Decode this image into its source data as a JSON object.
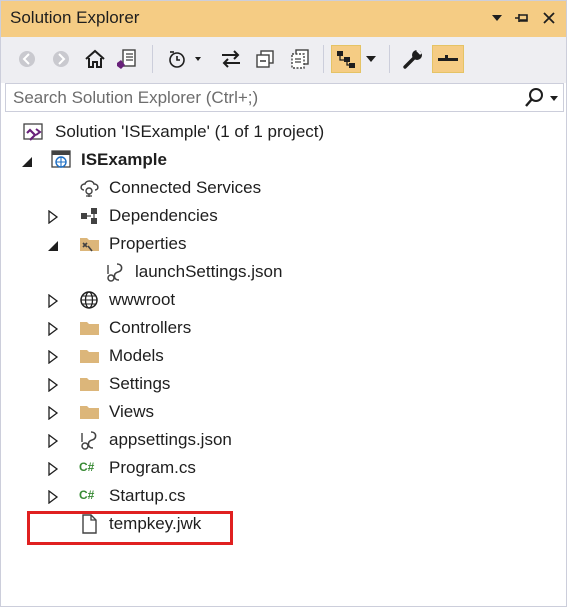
{
  "window": {
    "title": "Solution Explorer",
    "title_buttons": [
      "dropdown-icon",
      "pin-icon",
      "close-icon"
    ]
  },
  "toolbar": {
    "buttons": [
      "back-icon",
      "forward-icon",
      "home-icon",
      "switch-views-icon",
      "pending-changes-filter-icon",
      "sync-with-active-document-icon",
      "collapse-all-icon",
      "show-all-files-icon",
      "toggle-tree-icon",
      "properties-icon",
      "preview-selected-items-icon"
    ]
  },
  "search": {
    "placeholder": "Search Solution Explorer (Ctrl+;)",
    "value": ""
  },
  "tree": {
    "solution": "Solution 'ISExample' (1 of 1 project)",
    "project": "ISExample",
    "items": {
      "connected_services": "Connected Services",
      "dependencies": "Dependencies",
      "properties": "Properties",
      "launch_settings": "launchSettings.json",
      "wwwroot": "wwwroot",
      "controllers": "Controllers",
      "models": "Models",
      "settings": "Settings",
      "views": "Views",
      "appsettings": "appsettings.json",
      "program": "Program.cs",
      "startup": "Startup.cs",
      "tempkey": "tempkey.jwk"
    },
    "csharp_badge": "C#"
  },
  "colors": {
    "title_bar": "#f5cc84",
    "toolbar_bg": "#eeeef2",
    "folder": "#dcb67a",
    "csharp": "#388a34",
    "vs_purple": "#68217a",
    "highlight_border": "#e02020"
  }
}
